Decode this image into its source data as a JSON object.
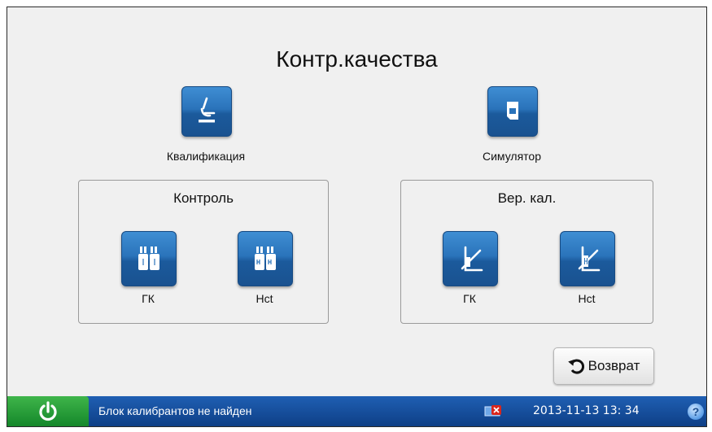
{
  "title": "Контр.качества",
  "qualification": {
    "label": "Квалификация",
    "icon": "microscope-icon"
  },
  "simulator": {
    "label": "Симулятор",
    "icon": "cartridge-icon"
  },
  "control": {
    "title": "Контроль",
    "buttons": [
      {
        "label": "ГК",
        "icon": "ampoule-icon"
      },
      {
        "label": "Hct",
        "icon": "ampoule-hct-icon"
      }
    ]
  },
  "calibration_verification": {
    "title": "Вер. кал.",
    "buttons": [
      {
        "label": "ГК",
        "icon": "calibration-tube-icon"
      },
      {
        "label": "Hct",
        "icon": "calibration-tube-hct-icon"
      }
    ]
  },
  "back_button": {
    "label": "Возврат",
    "icon": "return-arrow-icon"
  },
  "status_bar": {
    "message": "Блок калибрантов не найден",
    "datetime": "2013-11-13  13: 34",
    "help": "?"
  },
  "colors": {
    "button_blue": "#2a73ba",
    "status_bar_blue": "#1f5fb3",
    "power_green": "#2aa33c"
  }
}
